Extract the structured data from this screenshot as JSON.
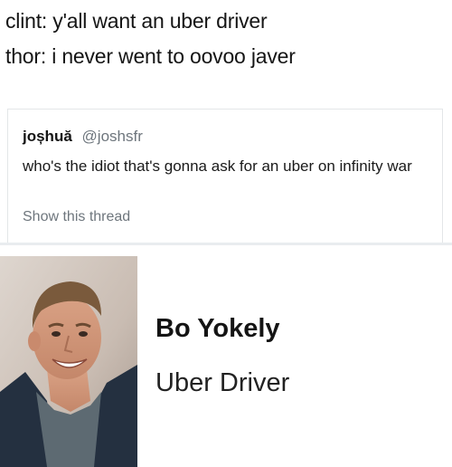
{
  "caption": {
    "lines": [
      "clint: y'all want an uber driver",
      "thor: i never went to oovoo javer"
    ]
  },
  "tweet": {
    "display_name": "joșhuă",
    "handle": "@joshsfr",
    "text": "who's the idiot that's gonna ask for an uber on infinity war",
    "thread_link": "Show this thread"
  },
  "profile": {
    "name": "Bo Yokely",
    "role": "Uber Driver",
    "photo_icon": "driver-portrait"
  },
  "colors": {
    "secondary_text": "#6e767d",
    "card_border": "#e3e6e8",
    "jacket": "#2a3442"
  }
}
